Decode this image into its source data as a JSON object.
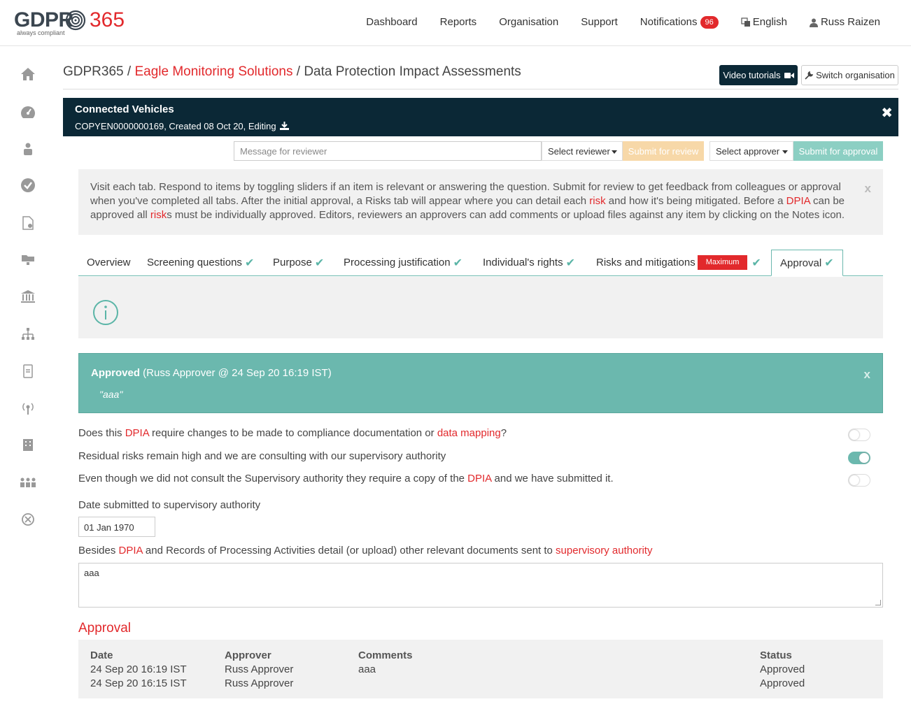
{
  "header": {
    "logo_main": "GDPR",
    "logo_num": "365",
    "logo_tag": "always compliant",
    "nav": [
      "Dashboard",
      "Reports",
      "Organisation",
      "Support",
      "Notifications"
    ],
    "notifications_count": "96",
    "language": "English",
    "user": "Russ Raizen"
  },
  "sidebar": {
    "icons": [
      "home-icon",
      "dashboard-gauge-icon",
      "user-icon",
      "check-circle-icon",
      "document-settings-icon",
      "folder-icon",
      "bank-icon",
      "org-chart-icon",
      "mobile-doc-icon",
      "broadcast-icon",
      "building-icon",
      "users-icon",
      "shield-x-icon"
    ]
  },
  "breadcrumb": {
    "root": "GDPR365",
    "sep": " / ",
    "org": "Eagle Monitoring Solutions",
    "page": "Data Protection Impact Assessments"
  },
  "buttons": {
    "video": "Video tutorials",
    "switch": "Switch organisation"
  },
  "record": {
    "title": "Connected Vehicles",
    "subtitle": "COPYEN0000000169, Created 08 Oct 20, Editing"
  },
  "review": {
    "message_placeholder": "Message for reviewer",
    "select_reviewer": "Select reviewer",
    "submit_review": "Submit for review",
    "select_approver": "Select approver",
    "submit_approval": "Submit for approval"
  },
  "info": {
    "p1": "Visit each tab. Respond to items by toggling sliders if an item is relevant or answering the question. Submit for review to get feedback from colleagues or approval when you've completed all tabs. After the initial approval, a Risks tab will appear where you can detail each ",
    "risk": "risk",
    "p2": " and how it's being mitigated. Before a ",
    "dpia": "DPIA",
    "p3": " can be approved all ",
    "risks": "risk",
    "p4": "s must be individually approved. Editors, reviewers an approvers can add comments or upload files against any item by clicking on the Notes icon.",
    "close": "x"
  },
  "tabs": [
    {
      "label": "Overview",
      "done": false
    },
    {
      "label": "Screening questions",
      "done": true
    },
    {
      "label": "Purpose",
      "done": true
    },
    {
      "label": "Processing justification",
      "done": true
    },
    {
      "label": "Individual's rights",
      "done": true
    },
    {
      "label": "Risks and mitigations",
      "done": true,
      "badge": "Maximum"
    },
    {
      "label": "Approval",
      "done": true
    }
  ],
  "approved_box": {
    "status": "Approved",
    "detail": " (Russ Approver @ 24 Sep 20 16:19 IST)",
    "comment": "\"aaa\"",
    "close": "x"
  },
  "questions": {
    "q1a": "Does this ",
    "q1b": "DPIA",
    "q1c": " require changes to be made to compliance documentation or ",
    "q1d": "data mapping",
    "q1e": "?",
    "q2": "Residual risks remain high and we are consulting with our supervisory authority",
    "q3a": "Even though we did not consult the Supervisory authority they require a copy of the ",
    "q3b": "DPIA",
    "q3c": " and we have submitted it.",
    "toggles": [
      false,
      true,
      false
    ]
  },
  "date_label": "Date submitted to supervisory authority",
  "date_value": "01 Jan 1970",
  "docs_label": {
    "a": "Besides ",
    "b": "DPIA",
    "c": " and Records of Processing Activities detail (or upload) other relevant documents sent to ",
    "d": "supervisory authority"
  },
  "docs_value": "aaa",
  "approval_section": {
    "title": "Approval",
    "headers": {
      "date": "Date",
      "approver": "Approver",
      "comments": "Comments",
      "status": "Status"
    },
    "rows": [
      {
        "date": "24 Sep 20 16:19 IST",
        "approver": "Russ Approver",
        "comments": "aaa",
        "status": "Approved"
      },
      {
        "date": "24 Sep 20 16:15 IST",
        "approver": "Russ Approver",
        "comments": "",
        "status": "Approved"
      }
    ]
  }
}
